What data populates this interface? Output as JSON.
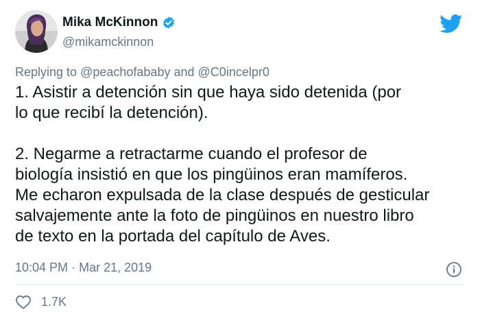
{
  "author": {
    "display_name": "Mika McKinnon",
    "handle": "@mikamckinnon",
    "verified": true,
    "avatar_icon": "profile-photo"
  },
  "brand": {
    "icon": "twitter-bird-icon",
    "color": "#1da1f2"
  },
  "reply_context": {
    "prefix": "Replying to",
    "mention_1": "@peachofababy",
    "joiner": "and",
    "mention_2": "@C0incelpr0"
  },
  "tweet": {
    "paragraph_1": "1.  Asistir a detención sin que haya sido detenida (por\nlo que recibí la detención).",
    "paragraph_2": "2.  Negarme a retractarme cuando el profesor de\nbiología insistió en que los pingüinos eran mamíferos.\nMe echaron expulsada de la clase después de gesticular\nsalvajemente ante la foto de pingüinos en nuestro libro\nde texto en la portada del capítulo de Aves."
  },
  "meta": {
    "time": "10:04 PM",
    "separator": "·",
    "date": "Mar 21, 2019",
    "info_icon": "info-icon"
  },
  "engagement": {
    "like_icon": "heart-icon",
    "like_count": "1.7K"
  },
  "colors": {
    "text": "#14171a",
    "secondary": "#657786",
    "verified_badge": "#1da1f2",
    "divider": "#e1e8ed"
  }
}
